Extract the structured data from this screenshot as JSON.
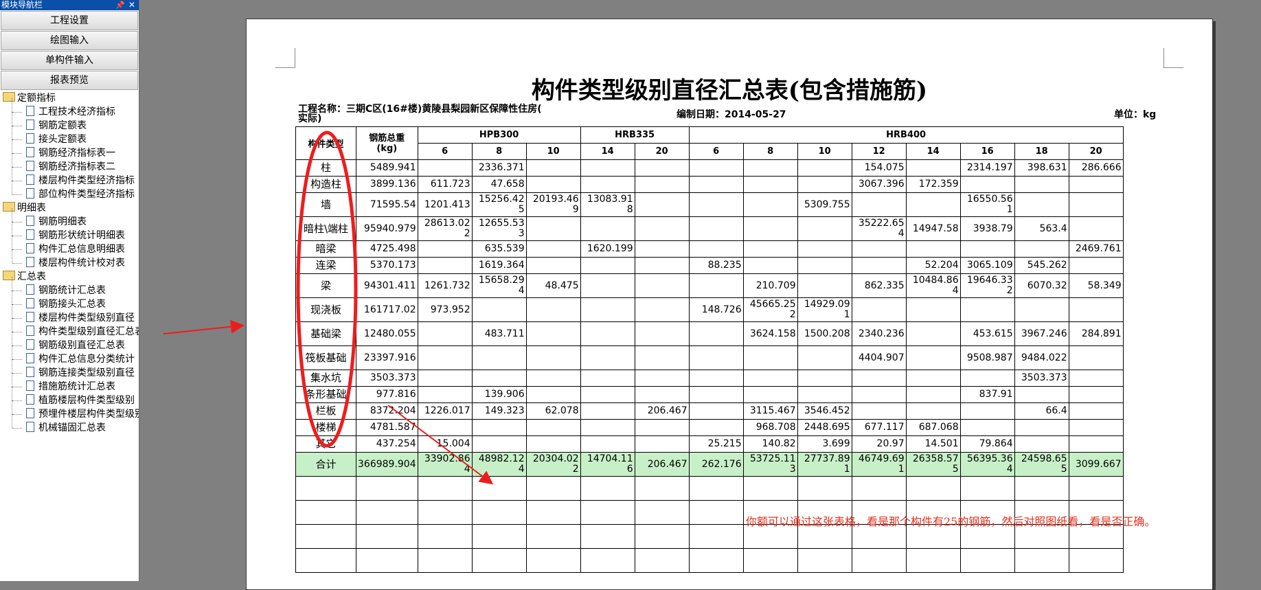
{
  "nav": {
    "title": "模块导航栏",
    "pin_icon": "📌",
    "close_icon": "✕",
    "buttons": [
      "工程设置",
      "绘图输入",
      "单构件输入",
      "报表预览"
    ],
    "tree": [
      {
        "type": "folder",
        "label": "定额指标"
      },
      {
        "type": "doc",
        "label": "工程技术经济指标"
      },
      {
        "type": "doc",
        "label": "钢筋定额表"
      },
      {
        "type": "doc",
        "label": "接头定额表"
      },
      {
        "type": "doc",
        "label": "钢筋经济指标表一"
      },
      {
        "type": "doc",
        "label": "钢筋经济指标表二"
      },
      {
        "type": "doc",
        "label": "楼层构件类型经济指标"
      },
      {
        "type": "doc",
        "label": "部位构件类型经济指标"
      },
      {
        "type": "folder",
        "label": "明细表"
      },
      {
        "type": "doc",
        "label": "钢筋明细表"
      },
      {
        "type": "doc",
        "label": "钢筋形状统计明细表"
      },
      {
        "type": "doc",
        "label": "构件汇总信息明细表"
      },
      {
        "type": "doc",
        "label": "楼层构件统计校对表"
      },
      {
        "type": "folder",
        "label": "汇总表"
      },
      {
        "type": "doc",
        "label": "钢筋统计汇总表"
      },
      {
        "type": "doc",
        "label": "钢筋接头汇总表"
      },
      {
        "type": "doc",
        "label": "楼层构件类型级别直径"
      },
      {
        "type": "doc",
        "label": "构件类型级别直径汇总表"
      },
      {
        "type": "doc",
        "label": "钢筋级别直径汇总表"
      },
      {
        "type": "doc",
        "label": "构件汇总信息分类统计"
      },
      {
        "type": "doc",
        "label": "钢筋连接类型级别直径"
      },
      {
        "type": "doc",
        "label": "措施筋统计汇总表"
      },
      {
        "type": "doc",
        "label": "植筋楼层构件类型级别"
      },
      {
        "type": "doc",
        "label": "预埋件楼层构件类型级别"
      },
      {
        "type": "doc",
        "label": "机械锚固汇总表"
      }
    ]
  },
  "report": {
    "title": "构件类型级别直径汇总表(包含措施筋)",
    "project_label": "工程名称：三期C区(16#楼)黄陵县梨园新区保障性住房(",
    "project_label_2": "实际)",
    "date_label": "编制日期：2014-05-27",
    "unit_label": "单位：kg",
    "header": {
      "col_type": "构件类型",
      "col_total": "钢筋总重\n(kg)",
      "groups": [
        {
          "name": "HPB300",
          "span": 3
        },
        {
          "name": "HRB335",
          "span": 2
        },
        {
          "name": "HRB400",
          "span": 8
        }
      ],
      "diameters": [
        "6",
        "8",
        "10",
        "14",
        "20",
        "6",
        "8",
        "10",
        "12",
        "14",
        "16",
        "18",
        "20"
      ]
    },
    "rows": [
      {
        "name": "柱",
        "total": "5489.941",
        "cells": [
          "",
          "2336.371",
          "",
          "",
          "",
          "",
          "",
          "",
          "154.075",
          "",
          "2314.197",
          "398.631",
          "286.666"
        ]
      },
      {
        "name": "构造柱",
        "total": "3899.136",
        "cells": [
          "611.723",
          "47.658",
          "",
          "",
          "",
          "",
          "",
          "",
          "3067.396",
          "172.359",
          "",
          "",
          ""
        ]
      },
      {
        "name": "墙",
        "total": "71595.54",
        "cells": [
          "1201.413",
          "15256.42\n5",
          "20193.46\n9",
          "13083.91\n8",
          "",
          "",
          "",
          "5309.755",
          "",
          "",
          "16550.56\n1",
          "",
          ""
        ],
        "tall": true
      },
      {
        "name": "暗柱\\端柱",
        "total": "95940.979",
        "cells": [
          "28613.02\n2",
          "12655.53\n3",
          "",
          "",
          "",
          "",
          "",
          "",
          "35222.65\n4",
          "14947.58",
          "3938.79",
          "563.4",
          ""
        ],
        "tall": true
      },
      {
        "name": "暗梁",
        "total": "4725.498",
        "cells": [
          "",
          "635.539",
          "",
          "1620.199",
          "",
          "",
          "",
          "",
          "",
          "",
          "",
          "",
          "2469.761"
        ]
      },
      {
        "name": "连梁",
        "total": "5370.173",
        "cells": [
          "",
          "1619.364",
          "",
          "",
          "",
          "88.235",
          "",
          "",
          "",
          "52.204",
          "3065.109",
          "545.262",
          ""
        ]
      },
      {
        "name": "梁",
        "total": "94301.411",
        "cells": [
          "1261.732",
          "15658.29\n4",
          "48.475",
          "",
          "",
          "",
          "210.709",
          "",
          "862.335",
          "10484.86\n4",
          "19646.33\n2",
          "6070.32",
          "58.349"
        ],
        "tall": true
      },
      {
        "name": "现浇板",
        "total": "161717.02",
        "cells": [
          "973.952",
          "",
          "",
          "",
          "",
          "148.726",
          "45665.25\n2",
          "14929.09\n1",
          "",
          "",
          "",
          "",
          ""
        ],
        "tall": true
      },
      {
        "name": "基础梁",
        "total": "12480.055",
        "cells": [
          "",
          "483.711",
          "",
          "",
          "",
          "",
          "3624.158",
          "1500.208",
          "2340.236",
          "",
          "453.615",
          "3967.246",
          "284.891"
        ],
        "tall": true
      },
      {
        "name": "筏板基础",
        "total": "23397.916",
        "cells": [
          "",
          "",
          "",
          "",
          "",
          "",
          "",
          "",
          "4404.907",
          "",
          "9508.987",
          "9484.022",
          ""
        ],
        "tall": true
      },
      {
        "name": "集水坑",
        "total": "3503.373",
        "cells": [
          "",
          "",
          "",
          "",
          "",
          "",
          "",
          "",
          "",
          "",
          "",
          "3503.373",
          ""
        ]
      },
      {
        "name": "条形基础",
        "total": "977.816",
        "cells": [
          "",
          "139.906",
          "",
          "",
          "",
          "",
          "",
          "",
          "",
          "",
          "837.91",
          "",
          ""
        ]
      },
      {
        "name": "栏板",
        "total": "8372.204",
        "cells": [
          "1226.017",
          "149.323",
          "62.078",
          "",
          "206.467",
          "",
          "3115.467",
          "3546.452",
          "",
          "",
          "",
          "66.4",
          ""
        ]
      },
      {
        "name": "楼梯",
        "total": "4781.587",
        "cells": [
          "",
          "",
          "",
          "",
          "",
          "",
          "968.708",
          "2448.695",
          "677.117",
          "687.068",
          "",
          "",
          ""
        ]
      },
      {
        "name": "其它",
        "total": "437.254",
        "cells": [
          "15.004",
          "",
          "",
          "",
          "",
          "25.215",
          "140.82",
          "3.699",
          "20.97",
          "14.501",
          "79.864",
          "",
          ""
        ]
      },
      {
        "name": "合计",
        "total": "366989.904",
        "cells": [
          "33902.86\n4",
          "48982.12\n4",
          "20304.02\n2",
          "14704.11\n6",
          "206.467",
          "262.176",
          "53725.11\n3",
          "27737.89\n1",
          "46749.69\n1",
          "26358.57\n5",
          "56395.36\n4",
          "24598.65\n5",
          "3099.667"
        ],
        "total_row": true,
        "tall": true
      }
    ],
    "blank_rows": 4
  },
  "annotation": {
    "note": "你额可以通过这张表格，看是那个构件有25的钢筋，然后对照图纸看，看是否正确。",
    "color": "#ee1d1d"
  }
}
